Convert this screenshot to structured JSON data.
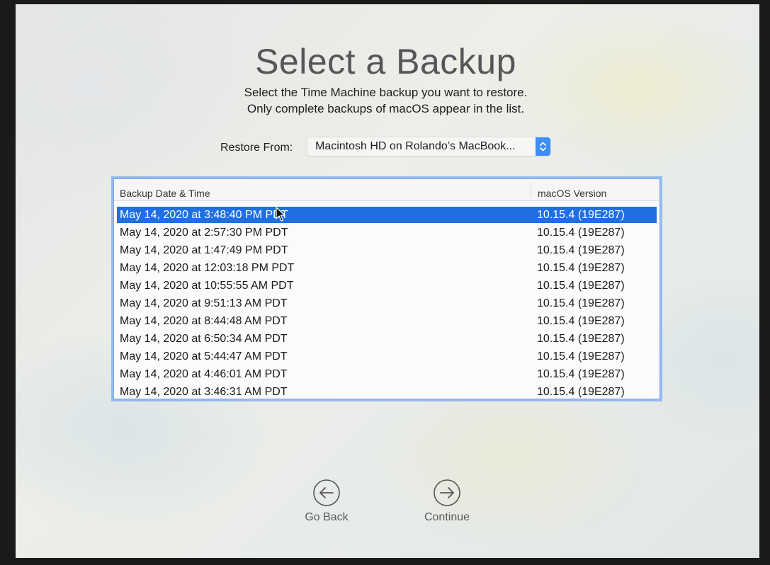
{
  "title": "Select a Backup",
  "subtitle_line1": "Select the Time Machine backup you want to restore.",
  "subtitle_line2": "Only complete backups of macOS appear in the list.",
  "restore_from": {
    "label": "Restore From:",
    "selected_value": "Macintosh HD on Rolando’s MacBook..."
  },
  "table": {
    "columns": [
      "Backup Date & Time",
      "macOS Version"
    ],
    "rows": [
      {
        "date": "May 14, 2020 at 3:48:40 PM PDT",
        "version": "10.15.4 (19E287)",
        "selected": true
      },
      {
        "date": "May 14, 2020 at 2:57:30 PM PDT",
        "version": "10.15.4 (19E287)"
      },
      {
        "date": "May 14, 2020 at 1:47:49 PM PDT",
        "version": "10.15.4 (19E287)"
      },
      {
        "date": "May 14, 2020 at 12:03:18 PM PDT",
        "version": "10.15.4 (19E287)"
      },
      {
        "date": "May 14, 2020 at 10:55:55 AM PDT",
        "version": "10.15.4 (19E287)"
      },
      {
        "date": "May 14, 2020 at 9:51:13 AM PDT",
        "version": "10.15.4 (19E287)"
      },
      {
        "date": "May 14, 2020 at 8:44:48 AM PDT",
        "version": "10.15.4 (19E287)"
      },
      {
        "date": "May 14, 2020 at 6:50:34 AM PDT",
        "version": "10.15.4 (19E287)"
      },
      {
        "date": "May 14, 2020 at 5:44:47 AM PDT",
        "version": "10.15.4 (19E287)"
      },
      {
        "date": "May 14, 2020 at 4:46:01 AM PDT",
        "version": "10.15.4 (19E287)"
      },
      {
        "date": "May 14, 2020 at 3:46:31 AM PDT",
        "version": "10.15.4 (19E287)"
      }
    ]
  },
  "buttons": {
    "go_back": {
      "label": "Go Back",
      "icon": "arrow-left-circle-icon"
    },
    "continue": {
      "label": "Continue",
      "icon": "arrow-right-circle-icon"
    }
  },
  "colors": {
    "selection": "#1f6fe3",
    "focus_ring": "#5894f0",
    "stepper": "#3d8ef7"
  }
}
